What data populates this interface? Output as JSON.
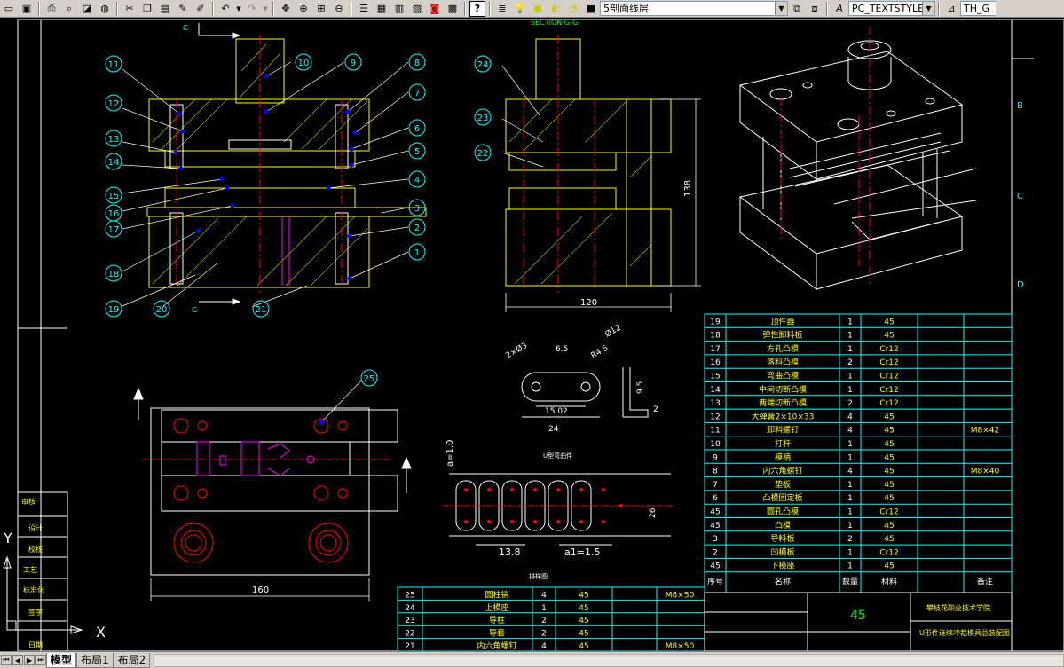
{
  "toolbar": {
    "layer_name": "5剖面线层",
    "text_style": "PC_TEXTSTYLE",
    "dim_style": "TH_G"
  },
  "tabs": [
    "模型",
    "布局1",
    "布局2"
  ],
  "views": {
    "section_label": "SECTION G-G",
    "cut_label": "G",
    "dim_height": "138",
    "dim_width": "120",
    "dim_plan": "160",
    "title_sheet_letters": [
      "B",
      "C",
      "D"
    ]
  },
  "balloons": {
    "left": [
      "11",
      "12",
      "13",
      "14",
      "15",
      "16",
      "17",
      "18",
      "19",
      "20",
      "10",
      "9",
      "8",
      "7",
      "6",
      "5",
      "4",
      "3",
      "2",
      "1",
      "21"
    ],
    "mid": [
      "24",
      "23",
      "22"
    ],
    "plan": "25"
  },
  "part_drawing": {
    "d1": "2×Ø3",
    "d2": "6.5",
    "d3": "R4.5",
    "d4": "Ø12",
    "d5": "15.02",
    "d6": "24",
    "d7": "9.5",
    "d8": "2",
    "caption": "U型弯曲件"
  },
  "strip": {
    "d1": "a=1.0",
    "d2": "13.8",
    "d3": "a1=1.5",
    "d4": "26",
    "caption": "排样图"
  },
  "bom_right": [
    {
      "no": "19",
      "name": "顶件器",
      "qty": "1",
      "mat": "45",
      "note": ""
    },
    {
      "no": "18",
      "name": "弹性卸料板",
      "qty": "1",
      "mat": "45",
      "note": ""
    },
    {
      "no": "17",
      "name": "方孔凸模",
      "qty": "1",
      "mat": "Cr12",
      "note": ""
    },
    {
      "no": "16",
      "name": "落料凸模",
      "qty": "2",
      "mat": "Cr12",
      "note": ""
    },
    {
      "no": "15",
      "name": "弯曲凸模",
      "qty": "1",
      "mat": "Cr12",
      "note": ""
    },
    {
      "no": "14",
      "name": "中间切断凸模",
      "qty": "1",
      "mat": "Cr12",
      "note": ""
    },
    {
      "no": "13",
      "name": "两端切断凸模",
      "qty": "2",
      "mat": "Cr12",
      "note": ""
    },
    {
      "no": "12",
      "name": "大弹簧2×10×33",
      "qty": "4",
      "mat": "45",
      "note": ""
    },
    {
      "no": "11",
      "name": "卸料螺钉",
      "qty": "4",
      "mat": "45",
      "note": "M8×42"
    },
    {
      "no": "10",
      "name": "打杆",
      "qty": "1",
      "mat": "45",
      "note": ""
    },
    {
      "no": "9",
      "name": "模柄",
      "qty": "1",
      "mat": "45",
      "note": ""
    },
    {
      "no": "8",
      "name": "内六角螺钉",
      "qty": "4",
      "mat": "45",
      "note": "M8×40"
    },
    {
      "no": "7",
      "name": "垫板",
      "qty": "1",
      "mat": "45",
      "note": ""
    },
    {
      "no": "6",
      "name": "凸模固定板",
      "qty": "1",
      "mat": "45",
      "note": ""
    },
    {
      "no": "45",
      "name": "圆孔凸模",
      "qty": "1",
      "mat": "Cr12",
      "note": ""
    },
    {
      "no": "45",
      "name": "凸模",
      "qty": "1",
      "mat": "45",
      "note": ""
    },
    {
      "no": "3",
      "name": "导料板",
      "qty": "2",
      "mat": "45",
      "note": ""
    },
    {
      "no": "2",
      "name": "凹模板",
      "qty": "1",
      "mat": "Cr12",
      "note": ""
    },
    {
      "no": "45",
      "name": "下模座",
      "qty": "1",
      "mat": "45",
      "note": ""
    }
  ],
  "bom_header": [
    "序号",
    "名称",
    "数量",
    "材料",
    "备注"
  ],
  "bom_bottom": [
    {
      "no": "25",
      "name": "圆柱销",
      "qty": "4",
      "mat": "45",
      "note": "M8×50"
    },
    {
      "no": "24",
      "name": "上模座",
      "qty": "1",
      "mat": "45",
      "note": ""
    },
    {
      "no": "23",
      "name": "导柱",
      "qty": "2",
      "mat": "45",
      "note": ""
    },
    {
      "no": "22",
      "name": "导套",
      "qty": "2",
      "mat": "45",
      "note": ""
    },
    {
      "no": "21",
      "name": "内六角螺钉",
      "qty": "4",
      "mat": "45",
      "note": "M8×50"
    }
  ],
  "title_block": {
    "material": "45",
    "school": "攀枝花职业技术学院",
    "drawing_name": "U形件连续冲裁模具总装配图"
  },
  "left_frame": [
    "审核",
    "设计",
    "校核",
    "工艺",
    "标准化",
    "签字",
    "日期"
  ],
  "ucs": {
    "x": "X",
    "y": "Y"
  },
  "colors": {
    "cyan": "#00ffff",
    "yellow": "#ffff00",
    "red": "#ff0000",
    "green": "#00ff00",
    "white": "#ffffff",
    "blue": "#0000ff",
    "magenta": "#ff00ff"
  }
}
